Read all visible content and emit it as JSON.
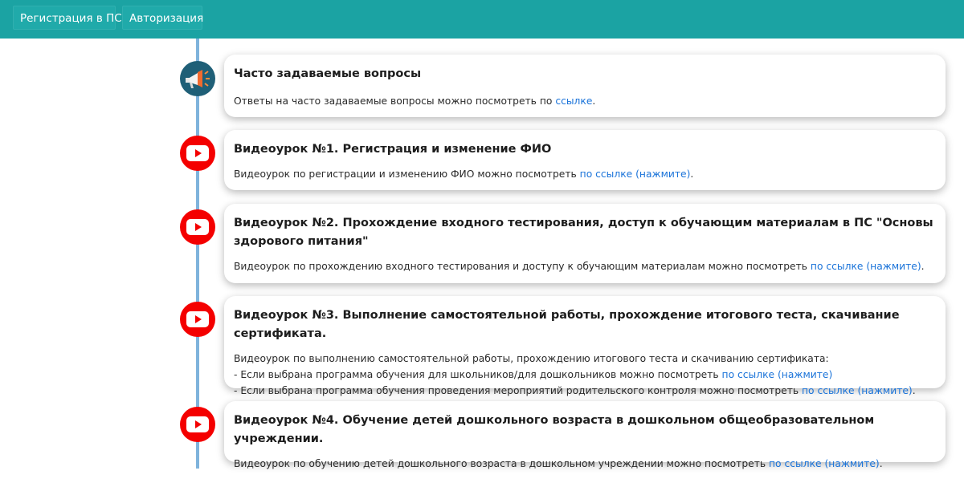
{
  "nav": {
    "registration_label": "Регистрация в ПС",
    "auth_label": "Авторизация"
  },
  "colors": {
    "topbar": "#1ba3a3",
    "timeline": "#7fb3dc",
    "youtube": "#f40000",
    "link": "#1a73d9"
  },
  "items": [
    {
      "icon": "megaphone-icon",
      "title": "Часто задаваемые вопросы",
      "text": "Ответы на часто задаваемые вопросы можно посмотреть по ",
      "link": "ссылке",
      "suffix": "."
    },
    {
      "icon": "youtube-icon",
      "title": "Видеоурок №1. Регистрация и изменение ФИО",
      "text": "Видеоурок по регистрации и изменению ФИО можно посмотреть ",
      "link": "по ссылке (нажмите)",
      "suffix": "."
    },
    {
      "icon": "youtube-icon",
      "title": "Видеоурок №2. Прохождение входного тестирования, доступ к обучающим материалам в ПС \"Основы здорового питания\"",
      "text": "Видеоурок по прохождению входного тестирования и доступу к обучающим материалам можно посмотреть ",
      "link": "по ссылке (нажмите)",
      "suffix": "."
    },
    {
      "icon": "youtube-icon",
      "title": "Видеоурок №3. Выполнение самостоятельной работы, прохождение итогового теста, скачивание сертификата.",
      "intro": "Видеоурок по выполнению самостоятельной работы, прохождению итогового теста и скачиванию сертификата:",
      "line1_text": "- Если выбрана программа обучения для школьников/для дошкольников можно посмотреть ",
      "line1_link": "по ссылке (нажмите)",
      "line2_text": "- Если выбрана программа обучения проведения мероприятий родительского контроля можно посмотреть ",
      "line2_link": "по ссылке (нажмите)",
      "suffix": "."
    },
    {
      "icon": "youtube-icon",
      "title": "Видеоурок №4. Обучение детей дошкольного возраста в дошкольном общеобразовательном учреждении.",
      "text": "Видеоурок по обучению детей дошкольного возраста в дошкольном учреждении можно посмотреть ",
      "link": "по ссылке (нажмите)",
      "suffix": "."
    }
  ]
}
